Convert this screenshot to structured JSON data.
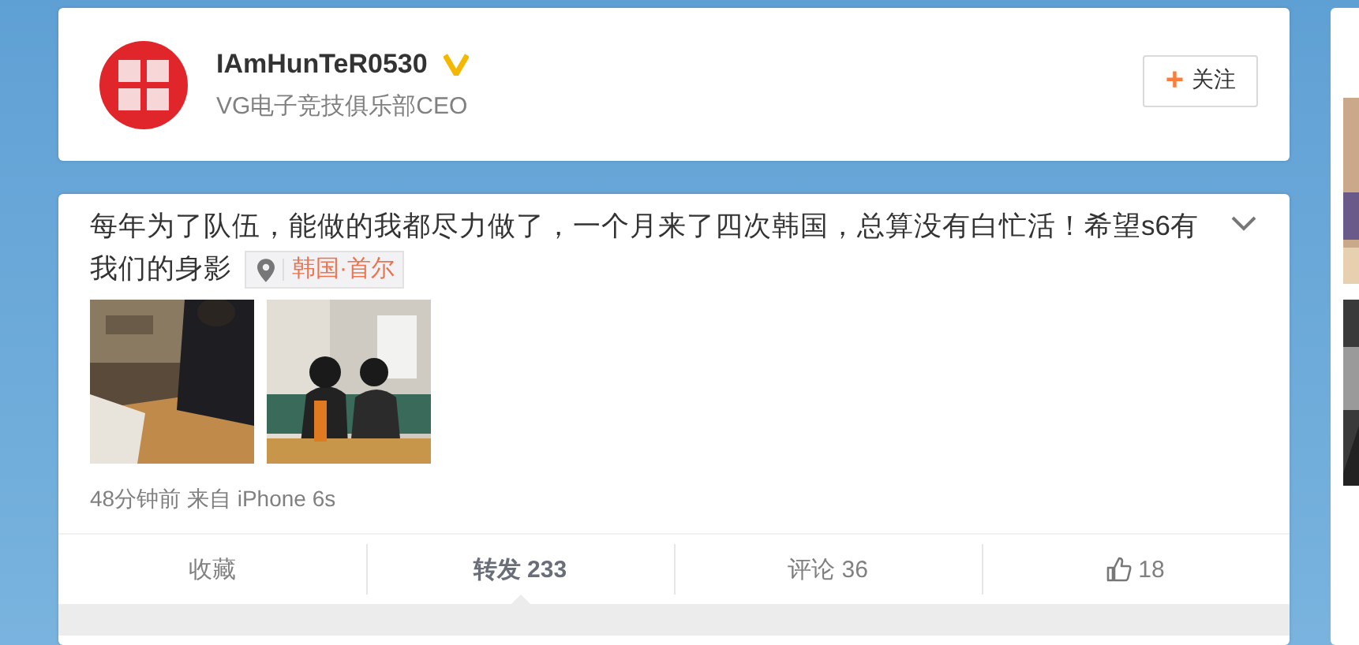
{
  "profile": {
    "name": "IAmHunTeR0530",
    "verified": true,
    "bio": "VG电子竞技俱乐部CEO",
    "follow_button": {
      "icon": "+",
      "label": "关注"
    }
  },
  "post": {
    "text": "每年为了队伍，能做的我都尽力做了，一个月来了四次韩国，总算没有白忙活！希望s6有我们的身影",
    "location": "韩国·首尔",
    "meta": "48分钟前 来自 iPhone 6s",
    "actions": [
      {
        "kind": "text",
        "label": "收藏",
        "selected": false
      },
      {
        "kind": "text",
        "label": "转发 233",
        "selected": true
      },
      {
        "kind": "text",
        "label": "评论 36",
        "selected": false
      },
      {
        "kind": "like",
        "label": "18",
        "selected": false
      }
    ]
  }
}
